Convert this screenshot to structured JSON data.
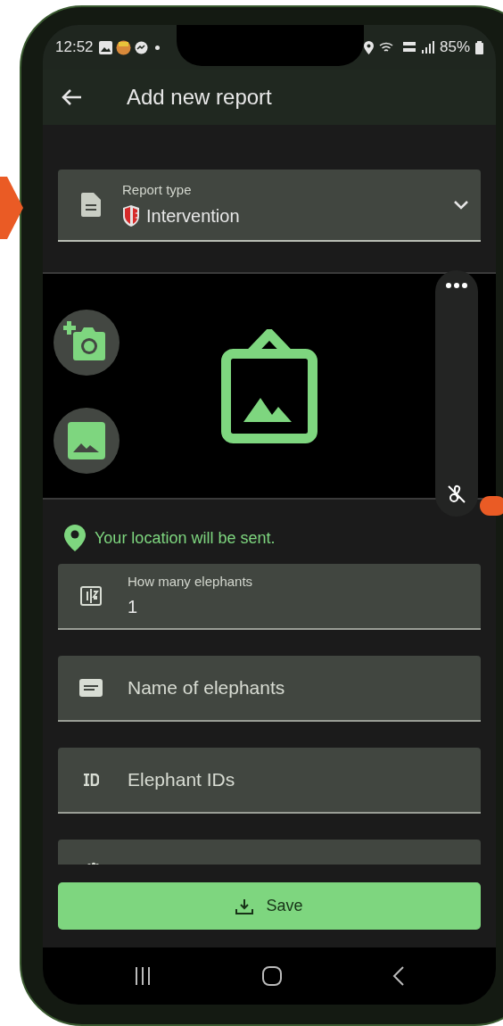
{
  "status_bar": {
    "time": "12:52",
    "battery": "85%"
  },
  "app_bar": {
    "title": "Add new report"
  },
  "report_type": {
    "label": "Report type",
    "value": "Intervention"
  },
  "location_note": "Your location will be sent.",
  "fields": [
    {
      "kind": "filled",
      "label": "How many elephants",
      "value": "1"
    },
    {
      "kind": "empty",
      "placeholder": "Name of elephants"
    },
    {
      "kind": "empty",
      "placeholder": "Elephant IDs"
    },
    {
      "kind": "cut"
    }
  ],
  "save_button": "Save"
}
